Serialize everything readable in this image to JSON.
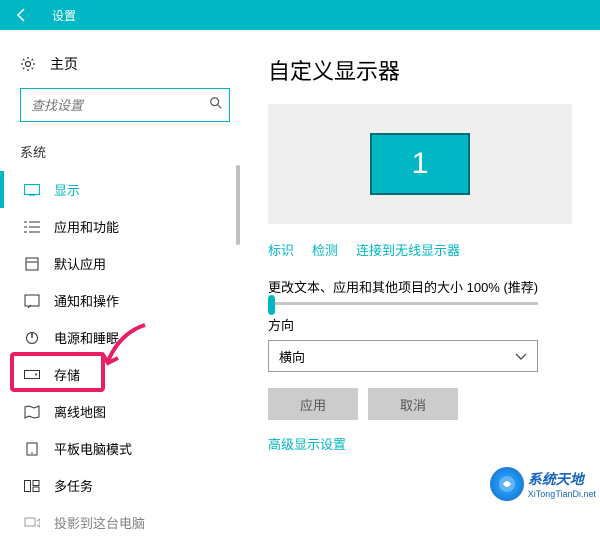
{
  "titlebar": {
    "title": "设置"
  },
  "sidebar": {
    "home": "主页",
    "search_placeholder": "查找设置",
    "section": "系统",
    "items": [
      {
        "label": "显示"
      },
      {
        "label": "应用和功能"
      },
      {
        "label": "默认应用"
      },
      {
        "label": "通知和操作"
      },
      {
        "label": "电源和睡眠"
      },
      {
        "label": "存储"
      },
      {
        "label": "离线地图"
      },
      {
        "label": "平板电脑模式"
      },
      {
        "label": "多任务"
      },
      {
        "label": "投影到这台电脑"
      }
    ]
  },
  "main": {
    "heading": "自定义显示器",
    "monitor_number": "1",
    "links": {
      "identify": "标识",
      "detect": "检测",
      "wireless": "连接到无线显示器"
    },
    "scale_label": "更改文本、应用和其他项目的大小 100% (推荐)",
    "orientation_label": "方向",
    "orientation_value": "横向",
    "apply": "应用",
    "cancel": "取消",
    "advanced": "高级显示设置"
  },
  "watermark": {
    "cn": "系统天地",
    "en": "XiTongTianDi.net"
  }
}
